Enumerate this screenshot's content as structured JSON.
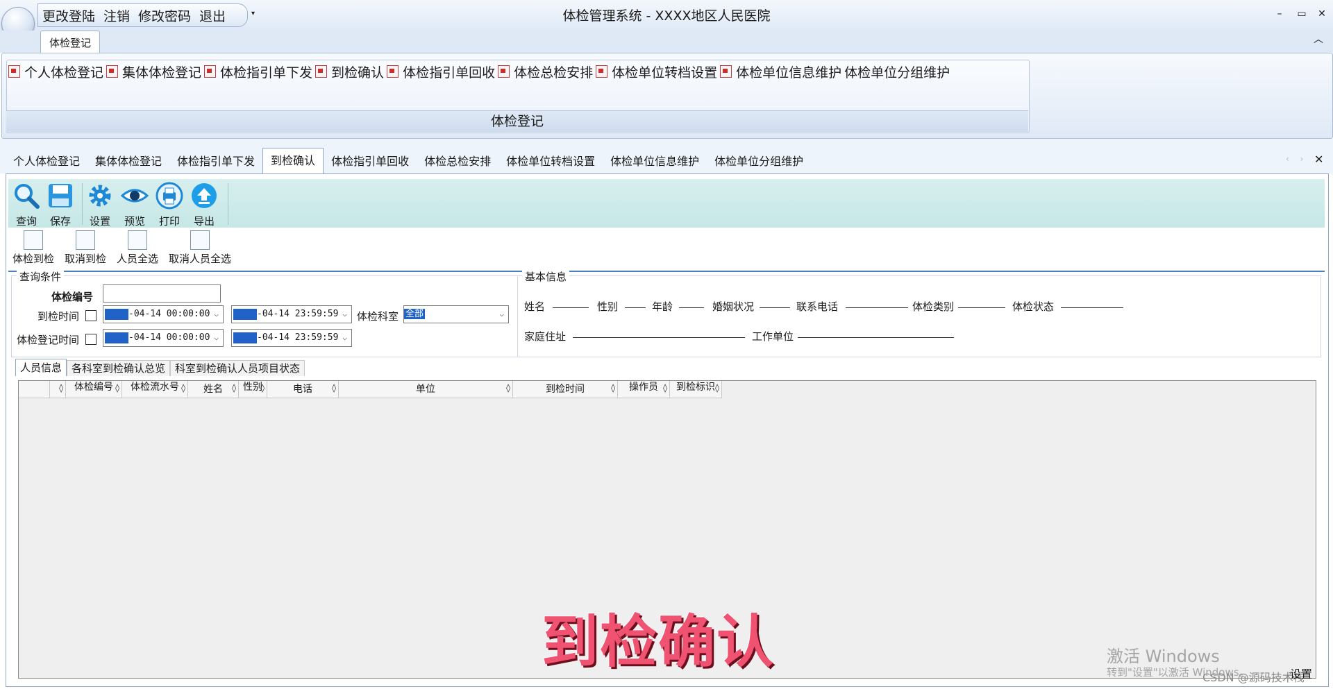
{
  "quick_access": {
    "items": [
      "更改登陆",
      "注销",
      "修改密码",
      "退出"
    ],
    "dropdown": "▾"
  },
  "window": {
    "title": "体检管理系统   -  XXXX地区人民医院",
    "minimize": "–",
    "maximize": "▭",
    "close": "✕"
  },
  "ribbon": {
    "tab": "体检登记",
    "collapse": "︿",
    "items": [
      "个人体检登记",
      "集体体检登记",
      "体检指引单下发",
      "到检确认",
      "体检指引单回收",
      "体检总检安排",
      "体检单位转档设置",
      "体检单位信息维护",
      "体检单位分组维护"
    ],
    "group_label": "体检登记"
  },
  "mdi_tabs": {
    "items": [
      "个人体检登记",
      "集体体检登记",
      "体检指引单下发",
      "到检确认",
      "体检指引单回收",
      "体检总检安排",
      "体检单位转档设置",
      "体检单位信息维护",
      "体检单位分组维护"
    ],
    "active_index": 3,
    "nav": "‹ ›",
    "close": "✕"
  },
  "toolbar": {
    "query": "查询",
    "save": "保存",
    "settings": "设置",
    "preview": "预览",
    "print": "打印",
    "export": "导出"
  },
  "subtoolbar": {
    "checkin": "体检到检",
    "cancel_checkin": "取消到检",
    "select_all": "人员全选",
    "cancel_select_all": "取消人员全选"
  },
  "query": {
    "title": "查询条件",
    "exam_no_label": "体检编号",
    "exam_no_value": "",
    "checkin_time_label": "到检时间",
    "checkin_from": "-04-14 00:00:00",
    "checkin_to": "-04-14 23:59:59",
    "dept_label": "体检科室",
    "dept_value": "全部",
    "reg_time_label": "体检登记时间",
    "reg_from": "-04-14 00:00:00",
    "reg_to": "-04-14 23:59:59"
  },
  "basic_info": {
    "title": "基本信息",
    "name": "姓名",
    "gender": "性别",
    "age": "年龄",
    "marital": "婚姻状况",
    "phone": "联系电话",
    "exam_type": "体检类别",
    "exam_status": "体检状态",
    "address": "家庭住址",
    "work_unit": "工作单位"
  },
  "bottom_tabs": [
    "人员信息",
    "各科室到检确认总览",
    "科室到检确认人员项目状态"
  ],
  "grid": {
    "columns": [
      "体检编号",
      "体检流水号",
      "姓名",
      "性别",
      "电话",
      "单位",
      "到检时间",
      "操作员",
      "到检标识"
    ],
    "sort_glyph": "◊"
  },
  "overlay": {
    "banner": "到检确认",
    "activate_windows": "激活 Windows",
    "activate_hint": "转到\"设置\"以激活 Windows。",
    "csdn": "CSDN @源码技术栈",
    "settings": "设置"
  },
  "colors": {
    "accent": "#4c7fc0",
    "toolbar_bg": "#cbe9e8",
    "banner": "#f05272",
    "ribbon_bg": "#dfe9f6"
  }
}
